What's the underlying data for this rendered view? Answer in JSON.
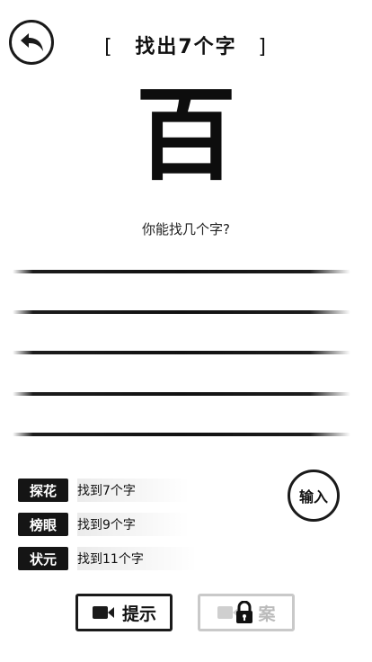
{
  "header": {
    "title": "找出7个字",
    "bracket_left": "[",
    "bracket_right": "]"
  },
  "puzzle": {
    "character": "百",
    "question": "你能找几个字?"
  },
  "answer_lines": 5,
  "ranks": [
    {
      "badge": "探花",
      "desc": "找到7个字"
    },
    {
      "badge": "榜眼",
      "desc": "找到9个字"
    },
    {
      "badge": "状元",
      "desc": "找到11个字"
    }
  ],
  "input_button": {
    "label": "输入"
  },
  "buttons": {
    "hint": {
      "label": "提示",
      "icon": "video-camera-icon"
    },
    "answer": {
      "label": "答案",
      "visible_label": "案",
      "icon": "lock-icon",
      "state": "locked"
    }
  },
  "colors": {
    "ink": "#111111",
    "disabled": "#c9c9c9"
  }
}
